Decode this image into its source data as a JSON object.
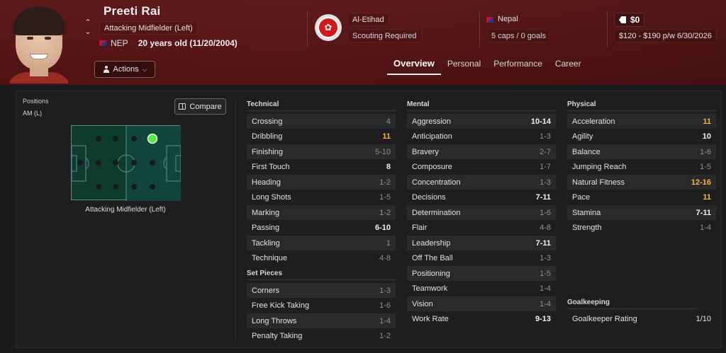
{
  "player": {
    "name": "Preeti Rai",
    "role": "Attacking Midfielder (Left)",
    "nation_code": "NEP",
    "age_text": "20 years old (11/20/2004)",
    "actions_label": "Actions"
  },
  "club": {
    "name": "Al-Etihad",
    "scouting": "Scouting Required"
  },
  "nation": {
    "name": "Nepal",
    "caps": "5 caps / 0 goals"
  },
  "contract": {
    "value": "$0",
    "wage": "$120 - $190 p/w  6/30/2026"
  },
  "tabs": [
    {
      "label": "Overview",
      "active": true
    },
    {
      "label": "Personal",
      "active": false
    },
    {
      "label": "Performance",
      "active": false
    },
    {
      "label": "Career",
      "active": false
    }
  ],
  "positions": {
    "label": "Positions",
    "value": "AM (L)",
    "compare_label": "Compare",
    "caption": "Attacking Midfielder (Left)"
  },
  "technical": {
    "title": "Technical",
    "items": [
      {
        "label": "Crossing",
        "value": "4",
        "tier": "low"
      },
      {
        "label": "Dribbling",
        "value": "11",
        "tier": "high"
      },
      {
        "label": "Finishing",
        "value": "5-10",
        "tier": "low"
      },
      {
        "label": "First Touch",
        "value": "8",
        "tier": "mid"
      },
      {
        "label": "Heading",
        "value": "1-2",
        "tier": "low"
      },
      {
        "label": "Long Shots",
        "value": "1-5",
        "tier": "low"
      },
      {
        "label": "Marking",
        "value": "1-2",
        "tier": "low"
      },
      {
        "label": "Passing",
        "value": "6-10",
        "tier": "mid"
      },
      {
        "label": "Tackling",
        "value": "1",
        "tier": "low"
      },
      {
        "label": "Technique",
        "value": "4-8",
        "tier": "low"
      }
    ]
  },
  "set_pieces": {
    "title": "Set Pieces",
    "items": [
      {
        "label": "Corners",
        "value": "1-3",
        "tier": "low"
      },
      {
        "label": "Free Kick Taking",
        "value": "1-6",
        "tier": "low"
      },
      {
        "label": "Long Throws",
        "value": "1-4",
        "tier": "low"
      },
      {
        "label": "Penalty Taking",
        "value": "1-2",
        "tier": "low"
      }
    ]
  },
  "mental": {
    "title": "Mental",
    "items": [
      {
        "label": "Aggression",
        "value": "10-14",
        "tier": "mid"
      },
      {
        "label": "Anticipation",
        "value": "1-3",
        "tier": "low"
      },
      {
        "label": "Bravery",
        "value": "2-7",
        "tier": "low"
      },
      {
        "label": "Composure",
        "value": "1-7",
        "tier": "low"
      },
      {
        "label": "Concentration",
        "value": "1-3",
        "tier": "low"
      },
      {
        "label": "Decisions",
        "value": "7-11",
        "tier": "mid"
      },
      {
        "label": "Determination",
        "value": "1-6",
        "tier": "low"
      },
      {
        "label": "Flair",
        "value": "4-8",
        "tier": "low"
      },
      {
        "label": "Leadership",
        "value": "7-11",
        "tier": "mid"
      },
      {
        "label": "Off The Ball",
        "value": "1-3",
        "tier": "low"
      },
      {
        "label": "Positioning",
        "value": "1-5",
        "tier": "low"
      },
      {
        "label": "Teamwork",
        "value": "1-4",
        "tier": "low"
      },
      {
        "label": "Vision",
        "value": "1-4",
        "tier": "low"
      },
      {
        "label": "Work Rate",
        "value": "9-13",
        "tier": "mid"
      }
    ]
  },
  "physical": {
    "title": "Physical",
    "items": [
      {
        "label": "Acceleration",
        "value": "11",
        "tier": "high"
      },
      {
        "label": "Agility",
        "value": "10",
        "tier": "mid"
      },
      {
        "label": "Balance",
        "value": "1-6",
        "tier": "low"
      },
      {
        "label": "Jumping Reach",
        "value": "1-5",
        "tier": "low"
      },
      {
        "label": "Natural Fitness",
        "value": "12-16",
        "tier": "high"
      },
      {
        "label": "Pace",
        "value": "11",
        "tier": "high"
      },
      {
        "label": "Stamina",
        "value": "7-11",
        "tier": "mid"
      },
      {
        "label": "Strength",
        "value": "1-4",
        "tier": "low"
      }
    ]
  },
  "goalkeeping": {
    "title": "Goalkeeping",
    "items": [
      {
        "label": "Goalkeeper Rating",
        "value": "1/10",
        "tier": "plain"
      }
    ]
  },
  "colors": {
    "header_red": "#5a1416",
    "accent_gold": "#f4b73a",
    "pitch_green": "#0f3b2f",
    "active_dot": "#5ee34a"
  },
  "icons": [
    "arrow-up-icon",
    "arrow-down-icon",
    "person-icon",
    "chevron-down-icon",
    "club-crest-icon",
    "flag-icon",
    "price-tag-icon",
    "compare-icon"
  ]
}
